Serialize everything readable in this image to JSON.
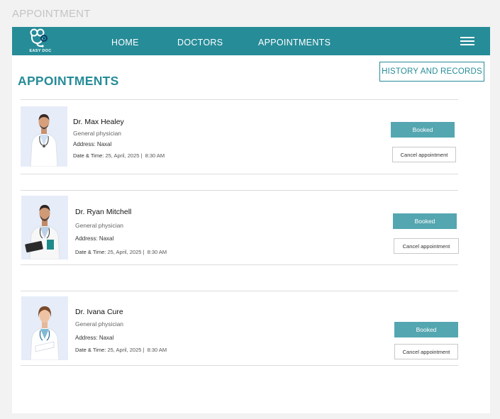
{
  "frame_label": "APPOINTMENT",
  "brand": {
    "name": "EASY DOC"
  },
  "nav": {
    "home": "HOME",
    "doctors": "DOCTORS",
    "appointments": "APPOINTMENTS"
  },
  "page_title": "APPOINTMENTS",
  "history_button": "HISTORY AND RECORDS",
  "colors": {
    "primary": "#268c98",
    "booked": "#54a6b0",
    "photo_bg": "#e6ecf8"
  },
  "appointments": [
    {
      "name": "Dr.  Max Healey",
      "specialty": "General physician",
      "address_label": "Address:",
      "address": "Naxal",
      "date_label": "Date & Time:",
      "date": "25, April, 2025",
      "time": "8:30 AM",
      "status": "Booked",
      "cancel": "Cancel appointment"
    },
    {
      "name": "Dr. Ryan Mitchell",
      "specialty": "General physician",
      "address_label": "Address:",
      "address": "Naxal",
      "date_label": "Date & Time:",
      "date": "25, April, 2025",
      "time": "8:30 AM",
      "status": "Booked",
      "cancel": "Cancel appointment"
    },
    {
      "name": "Dr. Ivana Cure",
      "specialty": "General physician",
      "address_label": "Address:",
      "address": "Naxal",
      "date_label": "Date & Time:",
      "date": "25, April, 2025",
      "time": "8:30 AM",
      "status": "Booked",
      "cancel": "Cancel appointment"
    }
  ]
}
